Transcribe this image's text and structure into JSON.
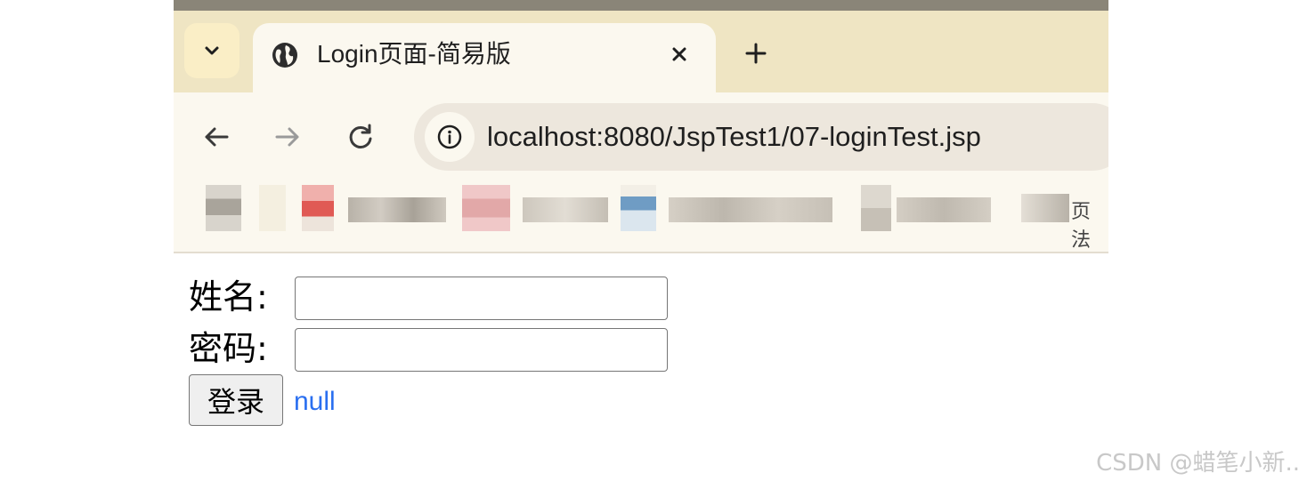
{
  "browser": {
    "tab": {
      "title": "Login页面-简易版"
    },
    "address_bar": {
      "url": "localhost:8080/JspTest1/07-loginTest.jsp"
    },
    "bookmarks_fragment": "页法"
  },
  "form": {
    "name_label": "姓名:",
    "name_value": "",
    "password_label": "密码:",
    "password_value": "",
    "submit_label": "登录",
    "result_text": "null"
  },
  "watermark": "CSDN @蜡笔小新..",
  "colors": {
    "tabbar_bg": "#efe5c3",
    "toolbar_bg": "#fbf8ef",
    "omnibox_bg": "#ede7dd",
    "result_text": "#2a6ff0"
  }
}
